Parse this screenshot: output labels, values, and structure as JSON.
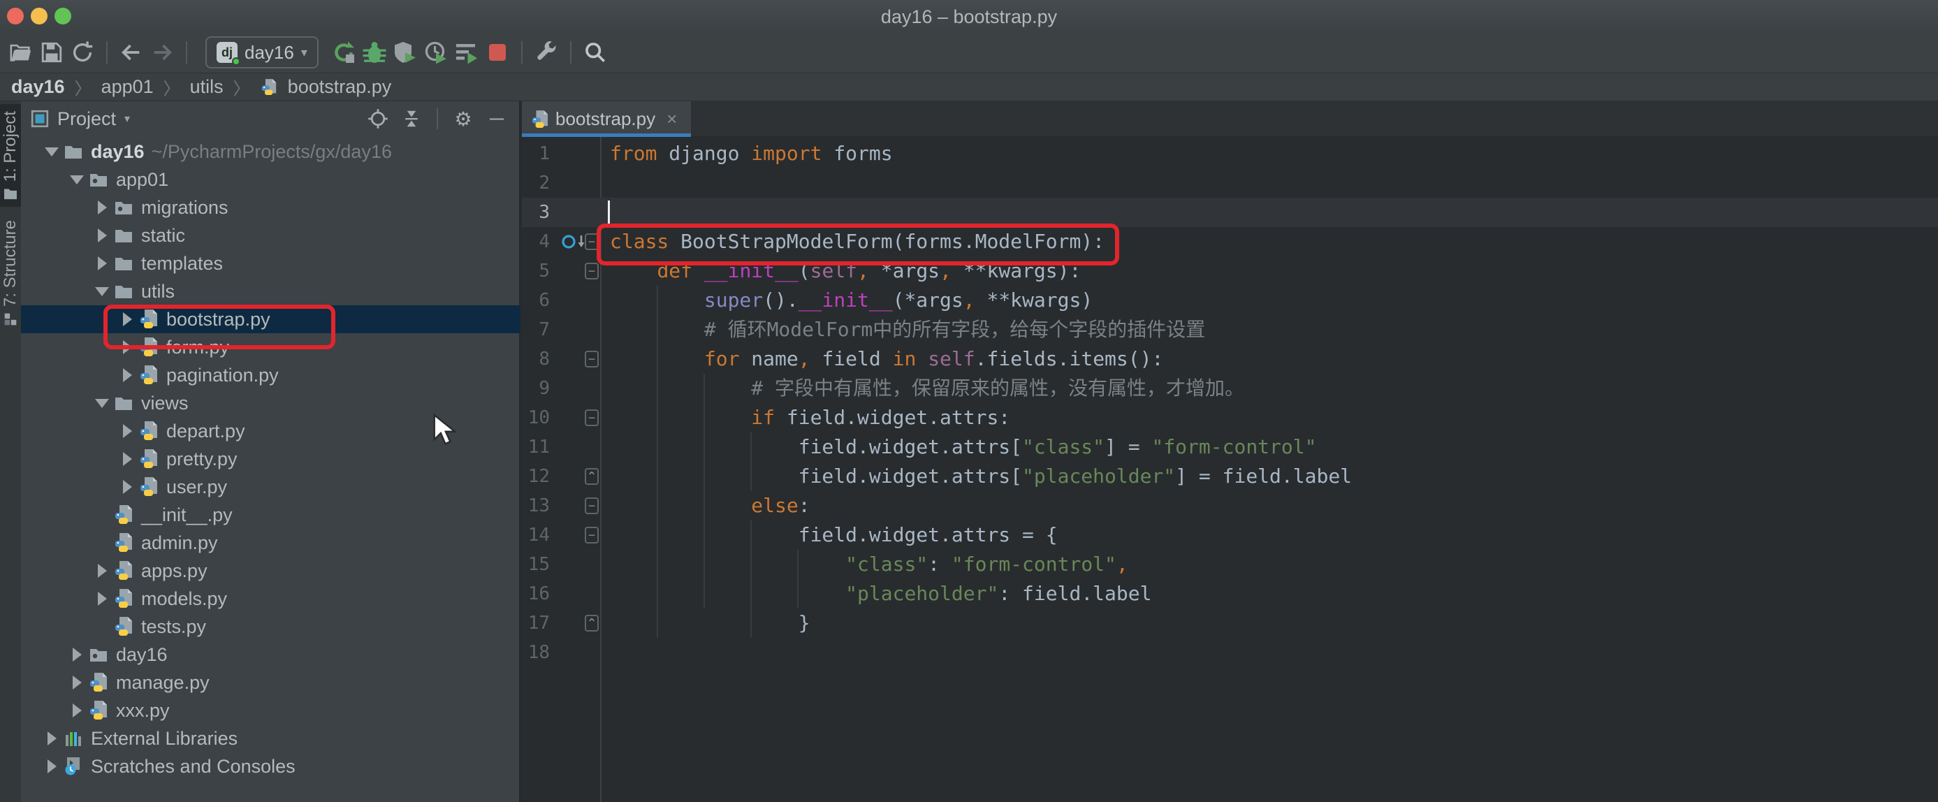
{
  "window": {
    "title": "day16 – bootstrap.py",
    "traffic_lights": [
      "#ec6a5e",
      "#f4bf4f",
      "#61c454"
    ]
  },
  "toolbar": {
    "run_config": {
      "label": "day16",
      "icon": "django-icon",
      "dropdown": "▾"
    },
    "icons": [
      "open-project",
      "save-all",
      "synchronize",
      "back",
      "forward",
      "rerun",
      "debug",
      "run-with-coverage",
      "profile",
      "concurrency-diagram",
      "stop",
      "wrench",
      "search"
    ]
  },
  "breadcrumbs": {
    "items": [
      {
        "label": "day16",
        "bold": true
      },
      {
        "label": "app01",
        "bold": false
      },
      {
        "label": "utils",
        "bold": false
      },
      {
        "label": "bootstrap.py",
        "bold": false,
        "icon": "python"
      }
    ],
    "separator": "〉"
  },
  "tool_stripe": {
    "project_label": "1: Project",
    "structure_label": "7: Structure"
  },
  "project_panel": {
    "title": "Project",
    "dropdown": "▾",
    "header_icons": [
      "locate-icon",
      "collapse-all-icon",
      "settings-gear-icon",
      "hide-panel-icon"
    ],
    "tree": [
      {
        "label": "day16",
        "sub": "~/PycharmProjects/gx/day16",
        "level": 0,
        "arrow": "open",
        "icon": "folder",
        "bold": true
      },
      {
        "label": "app01",
        "level": 1,
        "arrow": "open",
        "icon": "package"
      },
      {
        "label": "migrations",
        "level": 2,
        "arrow": "closed",
        "icon": "package"
      },
      {
        "label": "static",
        "level": 2,
        "arrow": "closed",
        "icon": "folder"
      },
      {
        "label": "templates",
        "level": 2,
        "arrow": "closed",
        "icon": "folder"
      },
      {
        "label": "utils",
        "level": 2,
        "arrow": "open",
        "icon": "folder"
      },
      {
        "label": "bootstrap.py",
        "level": 3,
        "arrow": "closed",
        "icon": "python",
        "selected": true
      },
      {
        "label": "form.py",
        "level": 3,
        "arrow": "closed",
        "icon": "python"
      },
      {
        "label": "pagination.py",
        "level": 3,
        "arrow": "closed",
        "icon": "python"
      },
      {
        "label": "views",
        "level": 2,
        "arrow": "open",
        "icon": "folder"
      },
      {
        "label": "depart.py",
        "level": 3,
        "arrow": "closed",
        "icon": "python"
      },
      {
        "label": "pretty.py",
        "level": 3,
        "arrow": "closed",
        "icon": "python"
      },
      {
        "label": "user.py",
        "level": 3,
        "arrow": "closed",
        "icon": "python"
      },
      {
        "label": "__init__.py",
        "level": 2,
        "arrow": "none",
        "icon": "python"
      },
      {
        "label": "admin.py",
        "level": 2,
        "arrow": "none",
        "icon": "python"
      },
      {
        "label": "apps.py",
        "level": 2,
        "arrow": "closed",
        "icon": "python"
      },
      {
        "label": "models.py",
        "level": 2,
        "arrow": "closed",
        "icon": "python"
      },
      {
        "label": "tests.py",
        "level": 2,
        "arrow": "none",
        "icon": "python"
      },
      {
        "label": "day16",
        "level": 1,
        "arrow": "closed",
        "icon": "package"
      },
      {
        "label": "manage.py",
        "level": 1,
        "arrow": "closed",
        "icon": "python"
      },
      {
        "label": "xxx.py",
        "level": 1,
        "arrow": "closed",
        "icon": "python"
      },
      {
        "label": "External Libraries",
        "level": 0,
        "arrow": "closed",
        "icon": "library"
      },
      {
        "label": "Scratches and Consoles",
        "level": 0,
        "arrow": "closed",
        "icon": "scratch"
      }
    ]
  },
  "editor": {
    "tab": {
      "label": "bootstrap.py",
      "close": "×"
    },
    "lines": [
      {
        "n": 1,
        "tokens": [
          [
            "k",
            "from"
          ],
          [
            "d",
            " django "
          ],
          [
            "k",
            "import"
          ],
          [
            "d",
            " forms"
          ]
        ]
      },
      {
        "n": 2,
        "tokens": []
      },
      {
        "n": 3,
        "tokens": [],
        "caret": true
      },
      {
        "n": 4,
        "tokens": [
          [
            "k",
            "class"
          ],
          [
            "d",
            " BootStrapModelForm(forms.ModelForm):"
          ]
        ],
        "fold": "minus",
        "gutter_icon": "overridden-marker",
        "boxed": true
      },
      {
        "n": 5,
        "tokens": [
          [
            "d",
            "    "
          ],
          [
            "k",
            "def "
          ],
          [
            "m",
            "__init__"
          ],
          [
            "d",
            "("
          ],
          [
            "s",
            "self"
          ],
          [
            "o",
            ","
          ],
          [
            "d",
            " *args"
          ],
          [
            "o",
            ","
          ],
          [
            "d",
            " **kwargs):"
          ]
        ],
        "fold": "minus"
      },
      {
        "n": 6,
        "tokens": [
          [
            "d",
            "        "
          ],
          [
            "b",
            "super"
          ],
          [
            "d",
            "()."
          ],
          [
            "m",
            "__init__"
          ],
          [
            "d",
            "(*args"
          ],
          [
            "o",
            ","
          ],
          [
            "d",
            " **kwargs)"
          ]
        ]
      },
      {
        "n": 7,
        "tokens": [
          [
            "d",
            "        "
          ],
          [
            "c",
            "# 循环ModelForm中的所有字段，给每个字段的插件设置"
          ]
        ]
      },
      {
        "n": 8,
        "tokens": [
          [
            "d",
            "        "
          ],
          [
            "k",
            "for"
          ],
          [
            "d",
            " name"
          ],
          [
            "o",
            ","
          ],
          [
            "d",
            " field "
          ],
          [
            "k",
            "in"
          ],
          [
            "d",
            " "
          ],
          [
            "s",
            "self"
          ],
          [
            "d",
            ".fields.items():"
          ]
        ],
        "fold": "minus"
      },
      {
        "n": 9,
        "tokens": [
          [
            "d",
            "            "
          ],
          [
            "c",
            "# 字段中有属性，保留原来的属性，没有属性，才增加。"
          ]
        ]
      },
      {
        "n": 10,
        "tokens": [
          [
            "d",
            "            "
          ],
          [
            "k",
            "if"
          ],
          [
            "d",
            " field.widget.attrs:"
          ]
        ],
        "fold": "minus"
      },
      {
        "n": 11,
        "tokens": [
          [
            "d",
            "                field.widget.attrs["
          ],
          [
            "t",
            "\"class\""
          ],
          [
            "d",
            "] = "
          ],
          [
            "t",
            "\"form-control\""
          ]
        ]
      },
      {
        "n": 12,
        "tokens": [
          [
            "d",
            "                field.widget.attrs["
          ],
          [
            "t",
            "\"placeholder\""
          ],
          [
            "d",
            "] = field.label"
          ]
        ],
        "fold": "end"
      },
      {
        "n": 13,
        "tokens": [
          [
            "d",
            "            "
          ],
          [
            "k",
            "else"
          ],
          [
            "d",
            ":"
          ]
        ],
        "fold": "minus"
      },
      {
        "n": 14,
        "tokens": [
          [
            "d",
            "                field.widget.attrs = {"
          ]
        ],
        "fold": "minus"
      },
      {
        "n": 15,
        "tokens": [
          [
            "d",
            "                    "
          ],
          [
            "t",
            "\"class\""
          ],
          [
            "d",
            ": "
          ],
          [
            "t",
            "\"form-control\""
          ],
          [
            "o",
            ","
          ]
        ]
      },
      {
        "n": 16,
        "tokens": [
          [
            "d",
            "                    "
          ],
          [
            "t",
            "\"placeholder\""
          ],
          [
            "d",
            ": field.label"
          ]
        ]
      },
      {
        "n": 17,
        "tokens": [
          [
            "d",
            "                }"
          ]
        ],
        "fold": "end"
      },
      {
        "n": 18,
        "tokens": []
      }
    ]
  },
  "annotations": {
    "tree_box_target": "bootstrap.py",
    "editor_box_target": "class BootStrapModelForm(forms.ModelForm):"
  },
  "colors": {
    "editor_bg": "#282c2e",
    "panel_bg": "#3c4245",
    "selection_row": "#0d2a42",
    "annotation_red": "#e2252c",
    "tab_underline": "#3a7dbe",
    "keyword": "#cc7832",
    "string": "#6a8759",
    "comment": "#7b8186",
    "magic_method": "#bf3fbf",
    "self_param": "#9e6b95",
    "builtin": "#8888c6",
    "default_text": "#a9b7c6",
    "caret_line": "#313539"
  }
}
